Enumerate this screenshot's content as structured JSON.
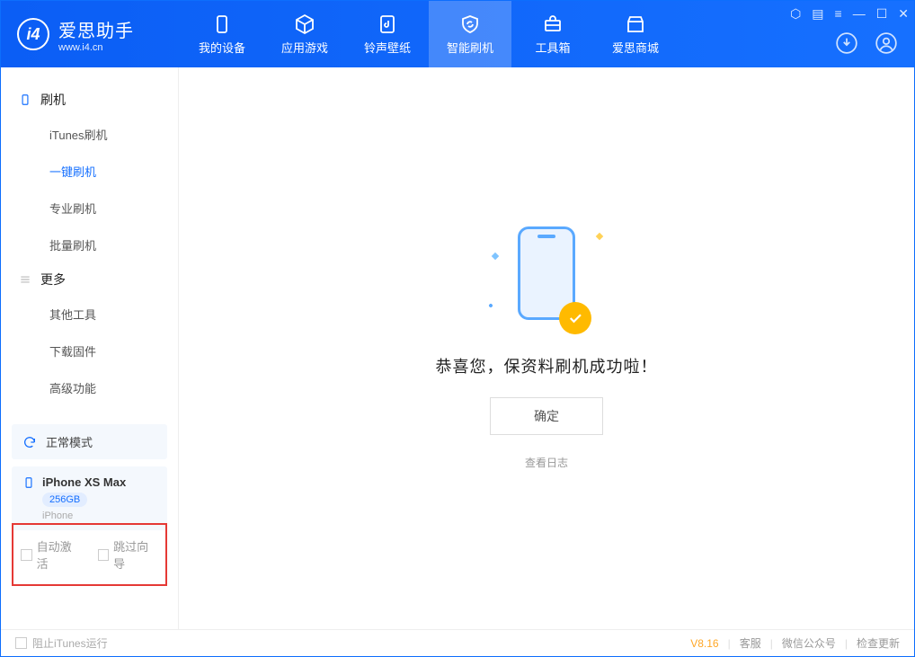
{
  "app": {
    "title": "爱思助手",
    "subtitle": "www.i4.cn"
  },
  "nav": {
    "tabs": [
      {
        "label": "我的设备"
      },
      {
        "label": "应用游戏"
      },
      {
        "label": "铃声壁纸"
      },
      {
        "label": "智能刷机"
      },
      {
        "label": "工具箱"
      },
      {
        "label": "爱思商城"
      }
    ]
  },
  "sidebar": {
    "section1": {
      "title": "刷机"
    },
    "items1": [
      {
        "label": "iTunes刷机"
      },
      {
        "label": "一键刷机"
      },
      {
        "label": "专业刷机"
      },
      {
        "label": "批量刷机"
      }
    ],
    "section2": {
      "title": "更多"
    },
    "items2": [
      {
        "label": "其他工具"
      },
      {
        "label": "下载固件"
      },
      {
        "label": "高级功能"
      }
    ]
  },
  "device": {
    "mode": "正常模式",
    "name": "iPhone XS Max",
    "storage": "256GB",
    "type": "iPhone"
  },
  "options": {
    "auto_activate": "自动激活",
    "skip_guide": "跳过向导"
  },
  "main": {
    "success": "恭喜您，保资料刷机成功啦！",
    "ok": "确定",
    "view_log": "查看日志"
  },
  "footer": {
    "block_itunes": "阻止iTunes运行",
    "version": "V8.16",
    "support": "客服",
    "wechat": "微信公众号",
    "check_update": "检查更新"
  }
}
